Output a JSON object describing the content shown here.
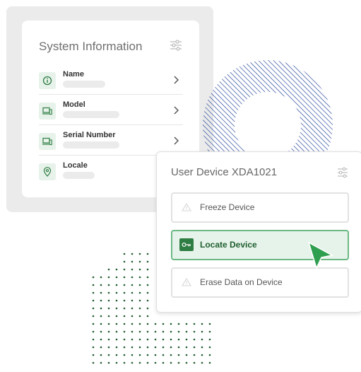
{
  "system_info": {
    "title": "System Information",
    "rows": [
      {
        "label": "Name",
        "icon": "info-icon"
      },
      {
        "label": "Model",
        "icon": "devices-icon"
      },
      {
        "label": "Serial Number",
        "icon": "devices-icon"
      },
      {
        "label": "Locale",
        "icon": "location-pin-icon"
      }
    ]
  },
  "device_panel": {
    "title": "User Device XDA1021",
    "actions": [
      {
        "label": "Freeze Device",
        "icon": "warning-icon"
      },
      {
        "label": "Locate Device",
        "icon": "key-icon"
      },
      {
        "label": "Erase Data on Device",
        "icon": "warning-icon"
      }
    ]
  },
  "colors": {
    "accent_green": "#2e7d43",
    "ring_blue": "#2b4a9b",
    "dot_green": "#1f5e2f"
  }
}
